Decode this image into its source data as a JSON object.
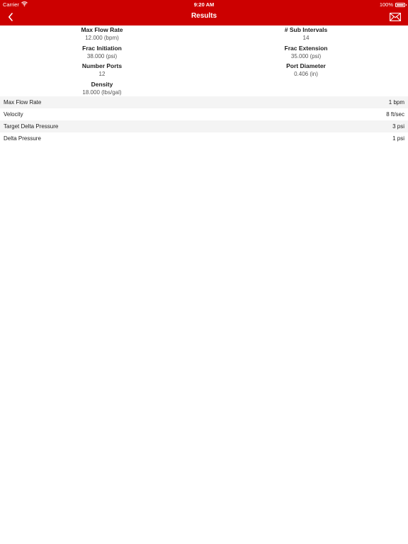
{
  "status_bar": {
    "carrier": "Carrier",
    "time": "9:20 AM",
    "battery": "100%"
  },
  "nav": {
    "title": "Results",
    "back_icon": "chevron-left-icon",
    "mail_icon": "mail-icon"
  },
  "inputs": {
    "left": [
      {
        "label": "Max Flow Rate",
        "value": "12.000 (bpm)"
      },
      {
        "label": "Frac Initiation",
        "value": "38.000 (psi)"
      },
      {
        "label": "Number Ports",
        "value": "12"
      },
      {
        "label": "Density",
        "value": "18.000 (lbs/gal)"
      }
    ],
    "right": [
      {
        "label": "# Sub Intervals",
        "value": "14"
      },
      {
        "label": "Frac Extension",
        "value": "35.000 (psi)"
      },
      {
        "label": "Port Diameter",
        "value": "0.406 (in)"
      }
    ]
  },
  "results": [
    {
      "label": "Max Flow Rate",
      "value": "1 bpm"
    },
    {
      "label": "Velocity",
      "value": "8 ft/sec"
    },
    {
      "label": "Target Delta Pressure",
      "value": "3 psi"
    },
    {
      "label": "Delta Pressure",
      "value": "1 psi"
    }
  ]
}
